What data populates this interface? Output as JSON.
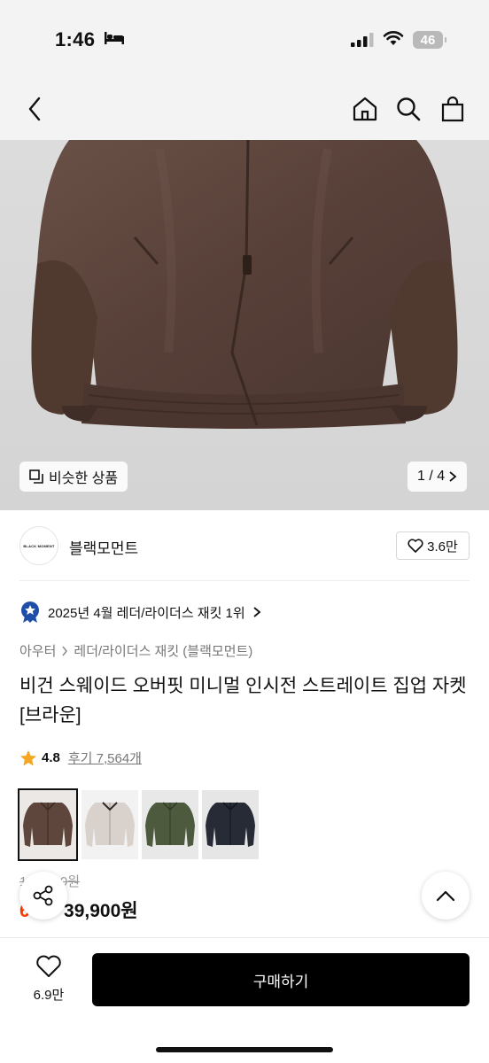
{
  "status_bar": {
    "time": "1:46",
    "battery": "46"
  },
  "product": {
    "image_counter": "1 / 4",
    "similar_label": "비슷한 상품",
    "brand": {
      "name": "블랙모먼트",
      "logo_text": "BLACK MOMENT",
      "likes": "3.6만"
    },
    "ranking": "2025년 4월 레더/라이더스 재킷 1위",
    "breadcrumb": {
      "category": "아우터",
      "subcategory": "레더/라이더스 재킷 (블랙모먼트)"
    },
    "title": "비건 스웨이드 오버핏 미니멀 인시전 스트레이트 집업 자켓 [브라운]",
    "rating": "4.8",
    "reviews": "후기 7,564개",
    "colors": [
      {
        "name": "brown",
        "hex": "#5e463c"
      },
      {
        "name": "ivory",
        "hex": "#d9d1cc"
      },
      {
        "name": "khaki",
        "hex": "#4d5a3d"
      },
      {
        "name": "navy",
        "hex": "#262b36"
      }
    ],
    "original_price": "129,900원",
    "discount": "69%",
    "price": "39,900원"
  },
  "bottom_bar": {
    "likes": "6.9만",
    "buy_label": "구매하기"
  },
  "colors": {
    "accent": "#ff3d00",
    "star": "#f5a623",
    "rank_badge": "#1f4ea8"
  }
}
